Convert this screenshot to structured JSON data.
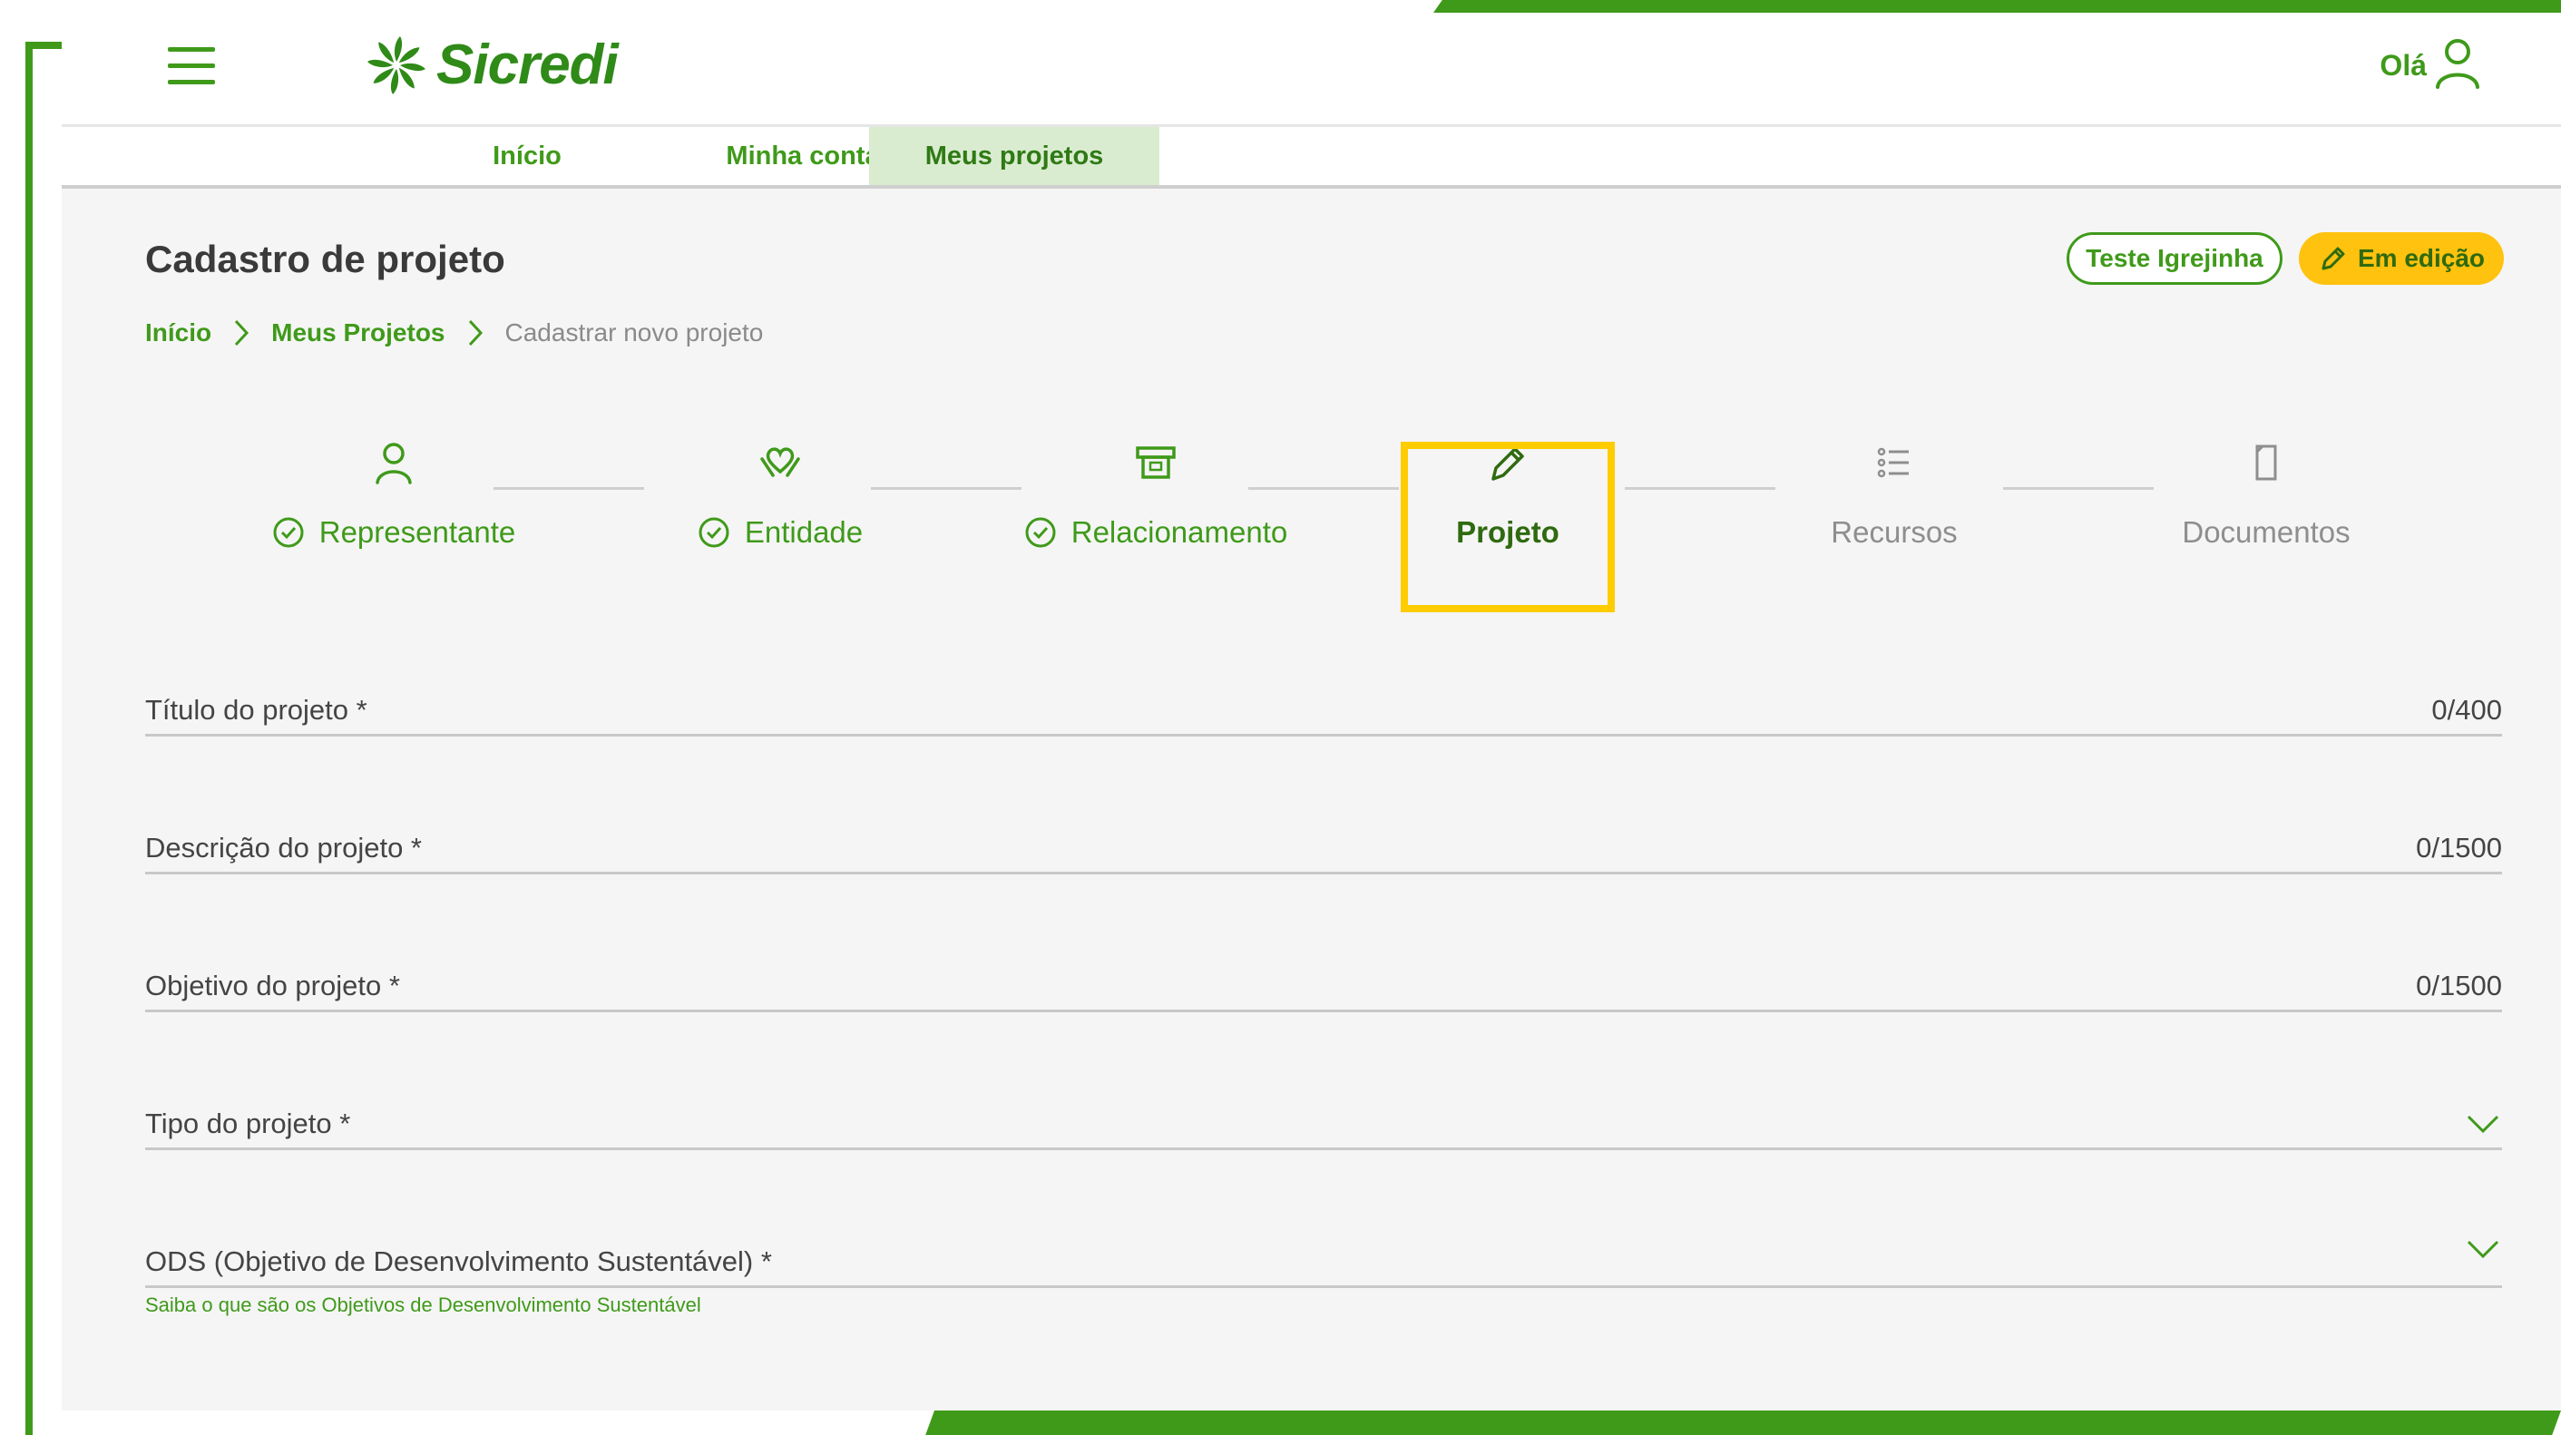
{
  "header": {
    "brand": "Sicredi",
    "greeting": "Olá"
  },
  "nav": {
    "tabs": [
      {
        "label": "Início"
      },
      {
        "label": "Minha conta"
      },
      {
        "label": "Meus projetos"
      }
    ],
    "active_tab": "Meus projetos"
  },
  "page": {
    "title": "Cadastro de projeto",
    "entity_badge": "Teste Igrejinha",
    "status_badge": "Em edição"
  },
  "breadcrumb": {
    "items": [
      "Início",
      "Meus Projetos",
      "Cadastrar novo projeto"
    ]
  },
  "stepper": {
    "steps": [
      {
        "label": "Representante",
        "icon": "person-icon",
        "state": "completed"
      },
      {
        "label": "Entidade",
        "icon": "heart-hands-icon",
        "state": "completed"
      },
      {
        "label": "Relacionamento",
        "icon": "card-reader-icon",
        "state": "completed"
      },
      {
        "label": "Projeto",
        "icon": "pencil-icon",
        "state": "active"
      },
      {
        "label": "Recursos",
        "icon": "list-icon",
        "state": "pending"
      },
      {
        "label": "Documentos",
        "icon": "document-icon",
        "state": "pending"
      }
    ]
  },
  "form": {
    "fields": [
      {
        "label": "Título do projeto *",
        "counter": "0/400",
        "type": "text"
      },
      {
        "label": "Descrição do projeto *",
        "counter": "0/1500",
        "type": "text"
      },
      {
        "label": "Objetivo do projeto *",
        "counter": "0/1500",
        "type": "text"
      },
      {
        "label": "Tipo do projeto *",
        "type": "select"
      },
      {
        "label": "ODS (Objetivo de Desenvolvimento Sustentável) *",
        "type": "select"
      }
    ],
    "helper_link": "Saiba o que são os Objetivos de Desenvolvimento Sustentável"
  },
  "colors": {
    "brand_green": "#3f9a1a",
    "status_yellow": "#ffc20e",
    "highlight": "#ffcc00"
  }
}
